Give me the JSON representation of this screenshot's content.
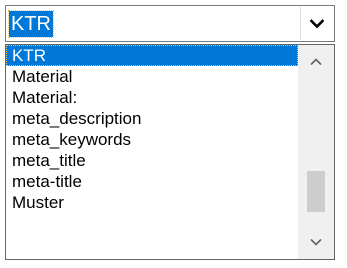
{
  "combobox": {
    "value": "KTR",
    "arrow_icon": "chevron-down-icon"
  },
  "dropdown": {
    "items": [
      {
        "label": "KTR",
        "selected": true
      },
      {
        "label": "Material",
        "selected": false
      },
      {
        "label": "Material:",
        "selected": false
      },
      {
        "label": "meta_description",
        "selected": false
      },
      {
        "label": "meta_keywords",
        "selected": false
      },
      {
        "label": "meta_title",
        "selected": false
      },
      {
        "label": "meta-title",
        "selected": false
      },
      {
        "label": "Muster",
        "selected": false
      }
    ],
    "scrollbar": {
      "up_icon": "chevron-up-icon",
      "down_icon": "chevron-down-icon",
      "position_fraction": 0.88,
      "visible_fraction": 0.28
    }
  },
  "colors": {
    "selection": "#0078d7",
    "selection_text": "#ffffff",
    "focus_outline": "#f4c24e",
    "scroll_thumb": "#cdcdcd",
    "scroll_track": "#f0f0f0"
  }
}
